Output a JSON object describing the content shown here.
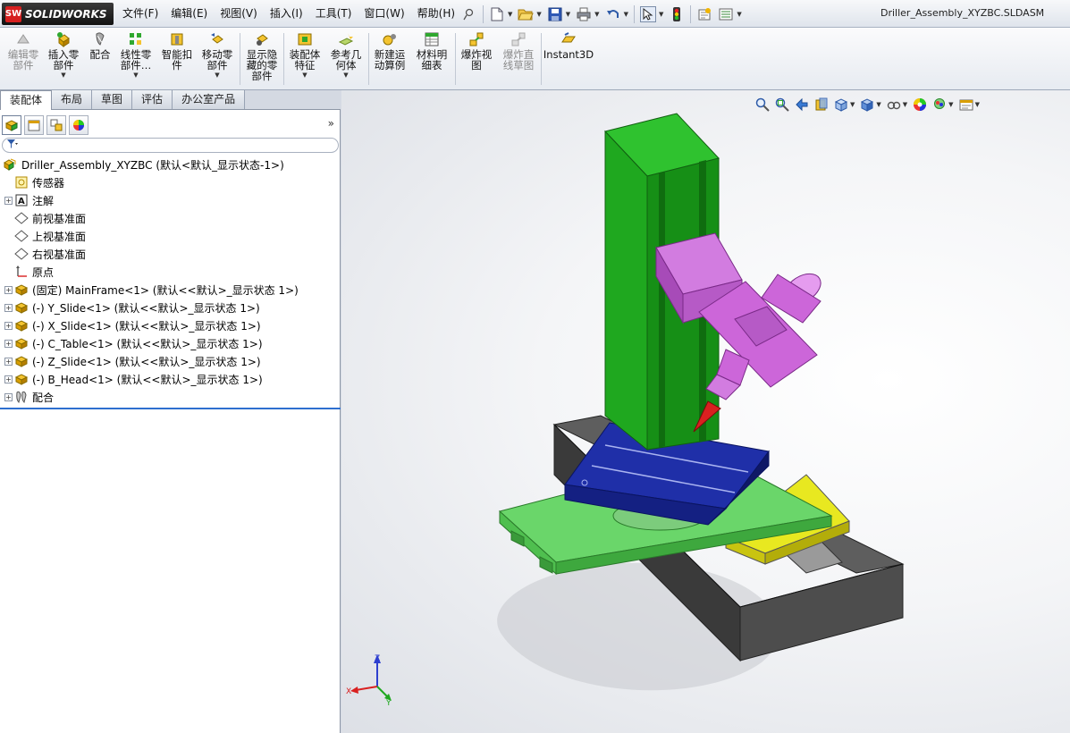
{
  "app": {
    "logo_prefix": "SW",
    "logo_text": "SOLIDWORKS",
    "window_title": "Driller_Assembly_XYZBC.SLDASM"
  },
  "menu": [
    "文件(F)",
    "编辑(E)",
    "视图(V)",
    "插入(I)",
    "工具(T)",
    "窗口(W)",
    "帮助(H)"
  ],
  "quick_access": [
    "new-icon",
    "open-icon",
    "save-icon",
    "print-icon",
    "undo-icon",
    "select-icon",
    "rebuild-icon",
    "options-icon",
    "customize-icon"
  ],
  "command_manager": [
    {
      "label": "编辑零\n部件",
      "icon": "edit-component-icon",
      "enabled": false,
      "dropdown": false
    },
    {
      "label": "插入零\n部件",
      "icon": "insert-components-icon",
      "enabled": true,
      "dropdown": true
    },
    {
      "label": "配合",
      "icon": "mate-icon",
      "enabled": true,
      "dropdown": false
    },
    {
      "label": "线性零\n部件…",
      "icon": "linear-pattern-icon",
      "enabled": true,
      "dropdown": true
    },
    {
      "label": "智能扣\n件",
      "icon": "smart-fasteners-icon",
      "enabled": true,
      "dropdown": false
    },
    {
      "label": "移动零\n部件",
      "icon": "move-component-icon",
      "enabled": true,
      "dropdown": true
    },
    {
      "label": "显示隐\n藏的零\n部件",
      "icon": "show-hidden-icon",
      "enabled": true,
      "dropdown": false
    },
    {
      "label": "装配体\n特征",
      "icon": "assembly-features-icon",
      "enabled": true,
      "dropdown": true
    },
    {
      "label": "参考几\n何体",
      "icon": "reference-geometry-icon",
      "enabled": true,
      "dropdown": true
    },
    {
      "label": "新建运\n动算例",
      "icon": "new-motion-study-icon",
      "enabled": true,
      "dropdown": false
    },
    {
      "label": "材料明\n细表",
      "icon": "bill-of-materials-icon",
      "enabled": true,
      "dropdown": false
    },
    {
      "label": "爆炸视\n图",
      "icon": "exploded-view-icon",
      "enabled": true,
      "dropdown": false
    },
    {
      "label": "爆炸直\n线草图",
      "icon": "explode-line-sketch-icon",
      "enabled": false,
      "dropdown": false
    },
    {
      "label": "Instant3D",
      "icon": "instant3d-icon",
      "enabled": true,
      "dropdown": false
    }
  ],
  "tabs": [
    "装配体",
    "布局",
    "草图",
    "评估",
    "办公室产品"
  ],
  "active_tab": "装配体",
  "manager_tabs": [
    "featuremanager-icon",
    "propertymanager-icon",
    "configurationmanager-icon",
    "displaymanager-icon"
  ],
  "tree": [
    {
      "label": "Driller_Assembly_XYZBC  (默认<默认_显示状态-1>)",
      "icon": "assembly-icon",
      "expander": false,
      "indent": 0
    },
    {
      "label": "传感器",
      "icon": "sensor-icon",
      "expander": false,
      "indent": 1
    },
    {
      "label": "注解",
      "icon": "annotation-icon",
      "expander": true,
      "indent": 1
    },
    {
      "label": "前视基准面",
      "icon": "plane-icon",
      "expander": false,
      "indent": 1,
      "highlight": true
    },
    {
      "label": "上视基准面",
      "icon": "plane-icon",
      "expander": false,
      "indent": 1
    },
    {
      "label": "右视基准面",
      "icon": "plane-icon",
      "expander": false,
      "indent": 1
    },
    {
      "label": "原点",
      "icon": "origin-icon",
      "expander": false,
      "indent": 1
    },
    {
      "label": "(固定) MainFrame<1> (默认<<默认>_显示状态 1>)",
      "icon": "part-icon",
      "expander": true,
      "indent": 1
    },
    {
      "label": "(-) Y_Slide<1> (默认<<默认>_显示状态 1>)",
      "icon": "part-icon",
      "expander": true,
      "indent": 1
    },
    {
      "label": "(-) X_Slide<1> (默认<<默认>_显示状态 1>)",
      "icon": "part-icon",
      "expander": true,
      "indent": 1
    },
    {
      "label": "(-) C_Table<1> (默认<<默认>_显示状态 1>)",
      "icon": "part-icon",
      "expander": true,
      "indent": 1
    },
    {
      "label": "(-) Z_Slide<1> (默认<<默认>_显示状态 1>)",
      "icon": "part-icon",
      "expander": true,
      "indent": 1
    },
    {
      "label": "(-) B_Head<1> (默认<<默认>_显示状态 1>)",
      "icon": "part-icon",
      "expander": true,
      "indent": 1
    },
    {
      "label": "配合",
      "icon": "mates-folder-icon",
      "expander": true,
      "indent": 1
    }
  ],
  "headsup_toolbar": [
    "zoom-to-fit-icon",
    "zoom-to-area-icon",
    "previous-view-icon",
    "section-view-icon",
    "view-orientation-icon",
    "display-style-icon",
    "hide-show-items-icon",
    "edit-appearance-icon",
    "apply-scene-icon",
    "view-settings-icon"
  ],
  "triad": {
    "x": "X",
    "y": "Y",
    "z": "Z"
  },
  "colors": {
    "frame": "#1fa81f",
    "head": "#cc66d9",
    "tool": "#d92020",
    "table": "#1f2fa8",
    "x_slide": "#6ad66a",
    "y_slide": "#e8e820",
    "base": "#4a4a4a",
    "accent": "#2e6fcf"
  }
}
